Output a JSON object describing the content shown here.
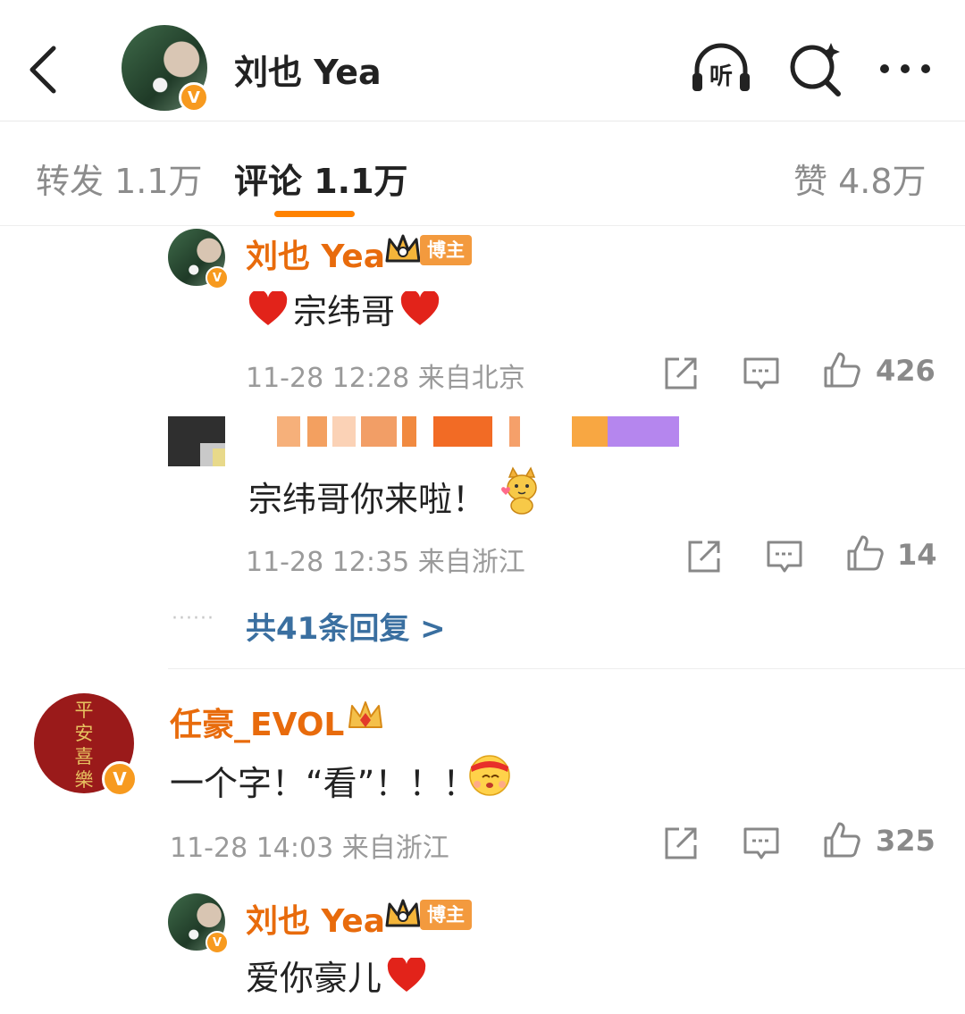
{
  "header": {
    "username": "刘也 Yea",
    "listen_label": "听",
    "verified_mark": "V",
    "icons": [
      "back-icon",
      "listen-headphone-icon",
      "search-icon",
      "more-icon"
    ]
  },
  "tabs": {
    "repost": "转发 1.1万",
    "comments": "评论 1.1万",
    "likes": "赞 4.8万"
  },
  "comments": [
    {
      "author": "刘也 Yea",
      "badge": "博主",
      "text": "宗纬哥",
      "time": "11-28 12:28",
      "location": "来自北京",
      "likes": "426"
    },
    {
      "author": "",
      "text": "宗纬哥你来啦！",
      "time": "11-28 12:35",
      "location": "来自浙江",
      "likes": "14"
    },
    {
      "more_dots": "······",
      "more_replies": "共41条回复 >"
    },
    {
      "author": "任豪_EVOL",
      "avatar_text": "平安喜樂",
      "text": "一个字！“看”！！！",
      "time": "11-28 14:03",
      "location": "来自浙江",
      "likes": "325"
    },
    {
      "author": "刘也 Yea",
      "badge": "博主",
      "text": "爱你豪儿"
    }
  ],
  "colors": {
    "accent": "#ff8200",
    "name": "#e86b0c",
    "link": "#3a6fa0",
    "meta": "#9a9a9a"
  }
}
